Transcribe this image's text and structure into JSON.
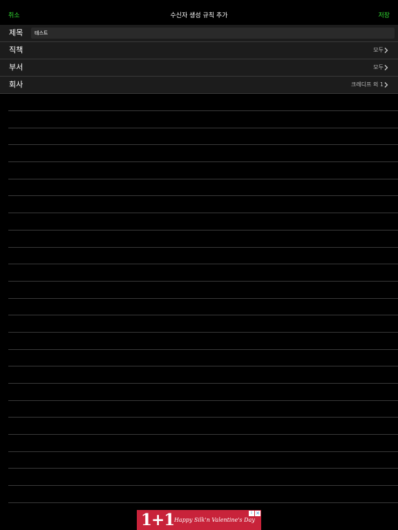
{
  "navbar": {
    "cancel_label": "취소",
    "title": "수신자 생성 규칙 추가",
    "save_label": "저장",
    "cancel_color": "#33dd33",
    "save_color": "#33dd33"
  },
  "form": {
    "title_row": {
      "label": "제목",
      "value": "테스트"
    },
    "position_row": {
      "label": "직책",
      "value": "모두"
    },
    "department_row": {
      "label": "부서",
      "value": "모두"
    },
    "company_row": {
      "label": "회사",
      "value": "크레디프 외 1"
    }
  },
  "ad": {
    "headline": "1+1",
    "text": "Happy Silk'n Valentine's Day",
    "info_glyph": "i",
    "close_glyph": "✕",
    "background": "#c8233a"
  }
}
